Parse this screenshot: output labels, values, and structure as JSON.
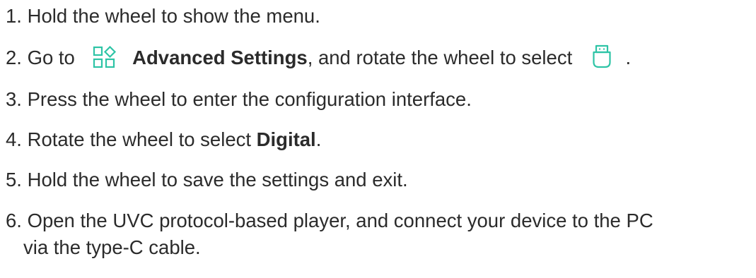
{
  "steps": [
    {
      "num": "1.",
      "text": "Hold the wheel to show the menu."
    },
    {
      "num": "2.",
      "pre": "Go to",
      "bold": "Advanced Settings",
      "mid": ", and rotate the wheel to select",
      "post": ".",
      "icon_a": "advanced-settings-icon",
      "icon_b": "usb-icon"
    },
    {
      "num": "3.",
      "text": "Press the wheel to enter the configuration interface."
    },
    {
      "num": "4.",
      "pre": "Rotate the wheel to select ",
      "bold": "Digital",
      "post": "."
    },
    {
      "num": "5.",
      "text": "Hold the wheel to save the settings and exit."
    },
    {
      "num": "6.",
      "text": "Open the UVC protocol-based player, and connect your device to the PC",
      "cont": "via the type-C cable."
    }
  ],
  "accent": "#2ec4a6"
}
